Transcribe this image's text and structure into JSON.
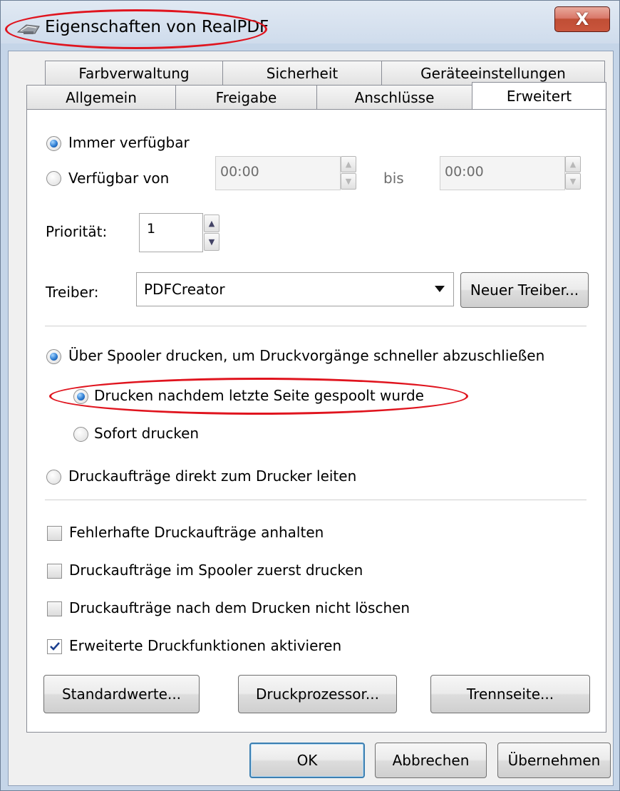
{
  "window": {
    "title": "Eigenschaften von RealPDF",
    "close_glyph": "X",
    "printer_icon": "printer-icon",
    "annotation_color": "#e0141e"
  },
  "tabs": {
    "row_back": [
      "Farbverwaltung",
      "Sicherheit",
      "Geräteeinstellungen"
    ],
    "row_front": [
      "Allgemein",
      "Freigabe",
      "Anschlüsse",
      "Erweitert"
    ],
    "active": "Erweitert"
  },
  "availability": {
    "always_label": "Immer verfügbar",
    "always_selected": true,
    "from_label": "Verfügbar von",
    "from_selected": false,
    "from_time": "00:00",
    "until_label": "bis",
    "until_time": "00:00"
  },
  "priority": {
    "label": "Priorität:",
    "value": "1"
  },
  "driver": {
    "label": "Treiber:",
    "selected": "PDFCreator",
    "new_button": "Neuer Treiber..."
  },
  "spooling": {
    "spool_label": "Über Spooler drucken, um Druckvorgänge schneller abzuschließen",
    "spool_selected": true,
    "after_last_page_label": "Drucken nachdem letzte Seite gespoolt wurde",
    "after_last_page_selected": true,
    "immediately_label": "Sofort drucken",
    "immediately_selected": false,
    "direct_label": "Druckaufträge direkt zum Drucker leiten",
    "direct_selected": false
  },
  "options": [
    {
      "label": "Fehlerhafte Druckaufträge anhalten",
      "checked": false
    },
    {
      "label": "Druckaufträge im Spooler zuerst drucken",
      "checked": false
    },
    {
      "label": "Druckaufträge nach dem Drucken nicht löschen",
      "checked": false
    },
    {
      "label": "Erweiterte Druckfunktionen aktivieren",
      "checked": true
    }
  ],
  "panel_buttons": {
    "defaults": "Standardwerte...",
    "processor": "Druckprozessor...",
    "separator_page": "Trennseite..."
  },
  "dialog_buttons": {
    "ok": "OK",
    "cancel": "Abbrechen",
    "apply": "Übernehmen"
  }
}
